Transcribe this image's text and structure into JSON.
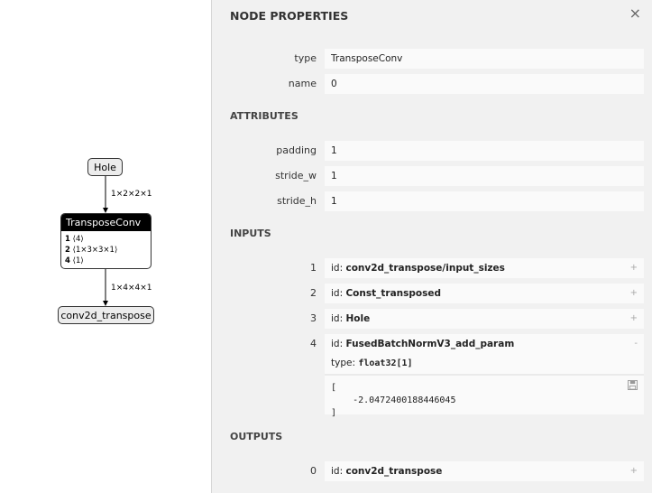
{
  "graph": {
    "input_node": "Hole",
    "op_node": {
      "title": "TransposeConv",
      "attrs": [
        {
          "index": "1",
          "shape": "⟨4⟩"
        },
        {
          "index": "2",
          "shape": "⟨1×3×3×1⟩"
        },
        {
          "index": "4",
          "shape": "⟨1⟩"
        }
      ]
    },
    "output_node": "conv2d_transpose",
    "edge_in_label": "1×2×2×1",
    "edge_out_label": "1×4×4×1"
  },
  "sidebar": {
    "title": "NODE PROPERTIES",
    "close_icon": "×",
    "node": [
      {
        "name": "type",
        "value": "TransposeConv"
      },
      {
        "name": "name",
        "value": "0"
      }
    ],
    "attributes_header": "ATTRIBUTES",
    "attributes": [
      {
        "name": "padding",
        "value": "1"
      },
      {
        "name": "stride_w",
        "value": "1"
      },
      {
        "name": "stride_h",
        "value": "1"
      }
    ],
    "inputs_header": "INPUTS",
    "inputs": [
      {
        "index": "1",
        "id_key": "id:",
        "id": "conv2d_transpose/input_sizes",
        "toggle": "+"
      },
      {
        "index": "2",
        "id_key": "id:",
        "id": "Const_transposed",
        "toggle": "+"
      },
      {
        "index": "3",
        "id_key": "id:",
        "id": "Hole",
        "toggle": "+"
      },
      {
        "index": "4",
        "id_key": "id:",
        "id": "FusedBatchNormV3_add_param",
        "toggle": "-",
        "type_key": "type:",
        "type": "float32[1]",
        "tensor_open": "[",
        "tensor_value": "    -2.0472400188446045",
        "tensor_close": "]"
      }
    ],
    "outputs_header": "OUTPUTS",
    "outputs": [
      {
        "index": "0",
        "id_key": "id:",
        "id": "conv2d_transpose",
        "toggle": "+"
      }
    ]
  }
}
